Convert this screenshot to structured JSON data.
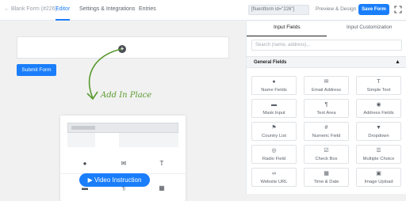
{
  "header": {
    "breadcrumb": "← Blank Form (#226)",
    "tabs": [
      {
        "label": "Editor",
        "active": true
      },
      {
        "label": "Settings & Integrations",
        "active": false
      },
      {
        "label": "Entries",
        "active": false
      }
    ],
    "shortcode": "[fluentform id=\"226\"]",
    "preview_label": "Preview & Design",
    "save_label": "Save Form",
    "accent_color": "#1a7efb"
  },
  "canvas": {
    "add_icon": "+",
    "submit_label": "Submit Form",
    "hint_label": "Add In Place",
    "mock_icons": [
      "user-icon",
      "envelope-icon",
      "text-icon",
      "mask-icon",
      "paragraph-icon",
      "card-icon"
    ],
    "video_label": "Video Instruction",
    "video_icon": "play-circle-icon"
  },
  "sidebar": {
    "tabs": [
      {
        "label": "Input Fields",
        "active": true
      },
      {
        "label": "Input Customization",
        "active": false
      }
    ],
    "search_placeholder": "Search (name, address)...",
    "group_title": "General Fields",
    "fields": [
      {
        "label": "Name Fields",
        "icon": "user-icon"
      },
      {
        "label": "Email Address",
        "icon": "envelope-icon"
      },
      {
        "label": "Simple Text",
        "icon": "text-icon"
      },
      {
        "label": "Mask Input",
        "icon": "mask-icon"
      },
      {
        "label": "Text Area",
        "icon": "textarea-icon"
      },
      {
        "label": "Address Fields",
        "icon": "pin-icon"
      },
      {
        "label": "Country List",
        "icon": "flag-icon"
      },
      {
        "label": "Numeric Field",
        "icon": "hash-icon"
      },
      {
        "label": "Dropdown",
        "icon": "dropdown-icon"
      },
      {
        "label": "Radio Field",
        "icon": "radio-icon"
      },
      {
        "label": "Check Box",
        "icon": "checkbox-icon"
      },
      {
        "label": "Multiple Choice",
        "icon": "list-icon"
      },
      {
        "label": "Website URL",
        "icon": "link-icon"
      },
      {
        "label": "Time & Date",
        "icon": "calendar-icon"
      },
      {
        "label": "Image Upload",
        "icon": "image-icon"
      }
    ]
  }
}
